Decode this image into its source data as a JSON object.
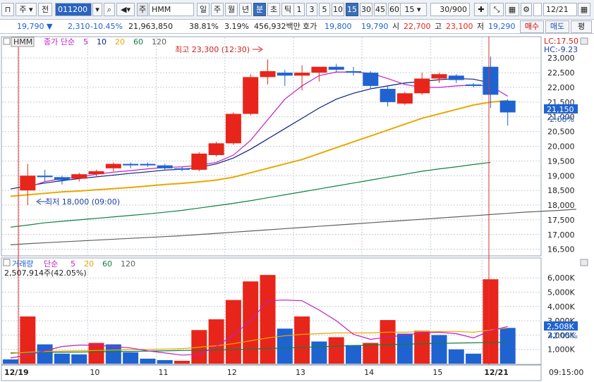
{
  "toolbar": {
    "market": "주",
    "prev": "전",
    "code": "011200",
    "tag": "주",
    "name": "HMM",
    "periods": [
      "일",
      "주",
      "월",
      "년",
      "분",
      "초",
      "틱"
    ],
    "selected_period": "분",
    "minutes": [
      "1",
      "3",
      "5",
      "10",
      "15",
      "30",
      "45",
      "60"
    ],
    "selected_minute": "15",
    "minute_select": "15",
    "count": "30/900",
    "date": "12/21"
  },
  "quote": {
    "price": "19,790",
    "change": "2,310",
    "change_pct": "-10.45%",
    "volume": "21,963,850",
    "turnover": "38.81%",
    "ratio": "3.19%",
    "amount": "456,932백만",
    "bid_label": "호가",
    "bid": "19,800",
    "ask": "19,790",
    "open_label": "시",
    "open": "22,700",
    "high_label": "고",
    "high": "23,100",
    "low_label": "저",
    "low": "19,290",
    "buy_button": "매수",
    "sell_button": "매도",
    "eval_button": "평"
  },
  "price_legend": {
    "name": "HMM",
    "type": "종가 단순",
    "ma": [
      "5",
      "10",
      "20",
      "60",
      "120"
    ],
    "ma_colors": [
      "#c020c0",
      "#102080",
      "#e8a800",
      "#108040",
      "#606060"
    ]
  },
  "annotations": {
    "high": "최고 23,300 (12:30)",
    "low": "최저 18,000 (09:00)"
  },
  "price_right": {
    "lc": "LC:17.50",
    "hc": "HC:-9.23",
    "current": "21,150",
    "current_pct": "-2.08%"
  },
  "volume_legend": {
    "title": "거래량",
    "type": "단순",
    "ma": [
      "5",
      "20",
      "60",
      "120"
    ],
    "value": "2,507,914주(42.05%)"
  },
  "volume_right": {
    "current": "2,508K",
    "pct": "42.05%"
  },
  "time_axis": {
    "labels": [
      "12/19",
      "10",
      "11",
      "12",
      "13",
      "14",
      "15",
      "12/21"
    ],
    "clock": "09:15:00"
  },
  "colors": {
    "up": "#e8251a",
    "down": "#1f63d1",
    "ma5": "#c020c0",
    "ma10": "#102080",
    "ma20": "#e8a800",
    "ma60": "#108040",
    "ma120": "#606060"
  },
  "chart_data": [
    {
      "type": "candlestick",
      "title": "HMM 15-minute",
      "y_ticks": [
        16500,
        17000,
        17500,
        18000,
        18500,
        19000,
        19500,
        20000,
        20500,
        21000,
        21500,
        22000,
        22500,
        23000
      ],
      "ylim": [
        16300,
        23700
      ],
      "candles": [
        {
          "o": 18500,
          "h": 19400,
          "l": 18000,
          "c": 19000
        },
        {
          "o": 19000,
          "h": 19200,
          "l": 18800,
          "c": 18950
        },
        {
          "o": 18950,
          "h": 19000,
          "l": 18700,
          "c": 18850
        },
        {
          "o": 18900,
          "h": 19100,
          "l": 18800,
          "c": 19050
        },
        {
          "o": 19050,
          "h": 19200,
          "l": 18950,
          "c": 19150
        },
        {
          "o": 19250,
          "h": 19450,
          "l": 19150,
          "c": 19400
        },
        {
          "o": 19400,
          "h": 19450,
          "l": 19250,
          "c": 19350
        },
        {
          "o": 19400,
          "h": 19450,
          "l": 19300,
          "c": 19350
        },
        {
          "o": 19350,
          "h": 19400,
          "l": 19200,
          "c": 19250
        },
        {
          "o": 19250,
          "h": 19300,
          "l": 19150,
          "c": 19200
        },
        {
          "o": 19200,
          "h": 19800,
          "l": 19150,
          "c": 19750
        },
        {
          "o": 19700,
          "h": 20150,
          "l": 19650,
          "c": 20100
        },
        {
          "o": 20100,
          "h": 21150,
          "l": 20050,
          "c": 21100
        },
        {
          "o": 21100,
          "h": 22450,
          "l": 21050,
          "c": 22350
        },
        {
          "o": 22350,
          "h": 22950,
          "l": 22100,
          "c": 22550
        },
        {
          "o": 22500,
          "h": 22600,
          "l": 22050,
          "c": 22400
        },
        {
          "o": 22400,
          "h": 22750,
          "l": 21900,
          "c": 22500
        },
        {
          "o": 22500,
          "h": 22700,
          "l": 22200,
          "c": 22700
        },
        {
          "o": 22700,
          "h": 22800,
          "l": 22500,
          "c": 22600
        },
        {
          "o": 22550,
          "h": 22700,
          "l": 22400,
          "c": 22500
        },
        {
          "o": 22500,
          "h": 22550,
          "l": 21950,
          "c": 22050
        },
        {
          "o": 21950,
          "h": 22050,
          "l": 21350,
          "c": 21500
        },
        {
          "o": 21450,
          "h": 21850,
          "l": 21400,
          "c": 21800
        },
        {
          "o": 21800,
          "h": 22500,
          "l": 21750,
          "c": 22300
        },
        {
          "o": 22300,
          "h": 22500,
          "l": 22150,
          "c": 22450
        },
        {
          "o": 22400,
          "h": 22450,
          "l": 22150,
          "c": 22250
        },
        {
          "o": 22100,
          "h": 22150,
          "l": 22000,
          "c": 22050
        },
        {
          "o": 22700,
          "h": 23050,
          "l": 21300,
          "c": 21750
        },
        {
          "o": 21550,
          "h": 21600,
          "l": 20700,
          "c": 21150
        }
      ],
      "ma5": [
        18600,
        18800,
        18900,
        18950,
        19050,
        19120,
        19170,
        19230,
        19280,
        19300,
        19350,
        19450,
        19700,
        20200,
        20900,
        21600,
        22050,
        22400,
        22520,
        22520,
        22480,
        22300,
        22100,
        22000,
        22000,
        22050,
        22080,
        22050,
        21700
      ],
      "ma10": [
        18550,
        18650,
        18750,
        18830,
        18900,
        18960,
        19020,
        19080,
        19130,
        19190,
        19220,
        19280,
        19400,
        19600,
        19900,
        20250,
        20600,
        20950,
        21300,
        21600,
        21800,
        21950,
        22050,
        22150,
        22200,
        22260,
        22300,
        22280,
        22150
      ],
      "ma20": [
        18300,
        18350,
        18400,
        18450,
        18480,
        18520,
        18560,
        18600,
        18650,
        18700,
        18740,
        18790,
        18850,
        18950,
        19100,
        19250,
        19400,
        19550,
        19750,
        19950,
        20150,
        20350,
        20550,
        20750,
        20950,
        21100,
        21250,
        21400,
        21500,
        21550
      ],
      "ma60": [
        17250,
        17320,
        17400,
        17450,
        17500,
        17550,
        17600,
        17650,
        17700,
        17760,
        17820,
        17900,
        17980,
        18060,
        18150,
        18250,
        18350,
        18450,
        18550,
        18650,
        18750,
        18850,
        18950,
        19050,
        19150,
        19230,
        19300,
        19380,
        19450
      ],
      "ma120": [
        16650,
        16690,
        16720,
        16750,
        16780,
        16810,
        16840,
        16870,
        16900,
        16930,
        16960,
        17000,
        17040,
        17080,
        17120,
        17160,
        17200,
        17240,
        17280,
        17320,
        17360,
        17400,
        17440,
        17480,
        17520,
        17560,
        17600,
        17640,
        17680,
        17720,
        17760,
        17790,
        17820,
        17860
      ]
    },
    {
      "type": "bar",
      "title": "거래량",
      "y_ticks": [
        1000,
        2000,
        3000,
        4000,
        5000,
        6000
      ],
      "y_tick_labels": [
        "1,000K",
        "2,000K",
        "3,000K",
        "4,000K",
        "5,000K",
        "6,000K"
      ],
      "ylim": [
        0,
        6700
      ],
      "values": [
        300,
        3300,
        1350,
        700,
        650,
        1450,
        1350,
        800,
        350,
        250,
        200,
        2350,
        3100,
        4450,
        5750,
        6200,
        2450,
        3300,
        1550,
        1850,
        1300,
        1450,
        3050,
        2100,
        2300,
        2000,
        1000,
        700,
        5900,
        2500
      ],
      "up": [
        false,
        true,
        false,
        false,
        false,
        true,
        false,
        false,
        false,
        false,
        true,
        true,
        true,
        true,
        true,
        true,
        false,
        true,
        false,
        true,
        false,
        true,
        true,
        false,
        true,
        false,
        false,
        false,
        true,
        false
      ],
      "ma5": [
        400,
        600,
        900,
        1200,
        1300,
        1300,
        1200,
        1100,
        900,
        750,
        600,
        650,
        1200,
        2000,
        3000,
        4400,
        4450,
        4400,
        3750,
        3000,
        2050,
        1700,
        1850,
        2000,
        2150,
        2200,
        2100,
        1800,
        2300,
        2600
      ],
      "ma20": [
        700,
        800,
        850,
        880,
        900,
        920,
        950,
        980,
        1000,
        1020,
        1050,
        1150,
        1250,
        1400,
        1600,
        1800,
        1950,
        2050,
        2100,
        2150,
        2150,
        2150,
        2200,
        2200,
        2250,
        2250,
        2250,
        2200,
        2350,
        2500
      ],
      "ma60": [
        750,
        760,
        780,
        800,
        810,
        830,
        850,
        860,
        880,
        900,
        920,
        940,
        960,
        990,
        1020,
        1060,
        1100,
        1140,
        1180,
        1220,
        1260,
        1300,
        1330,
        1360,
        1390,
        1420,
        1440,
        1460,
        1480,
        1500
      ]
    }
  ]
}
